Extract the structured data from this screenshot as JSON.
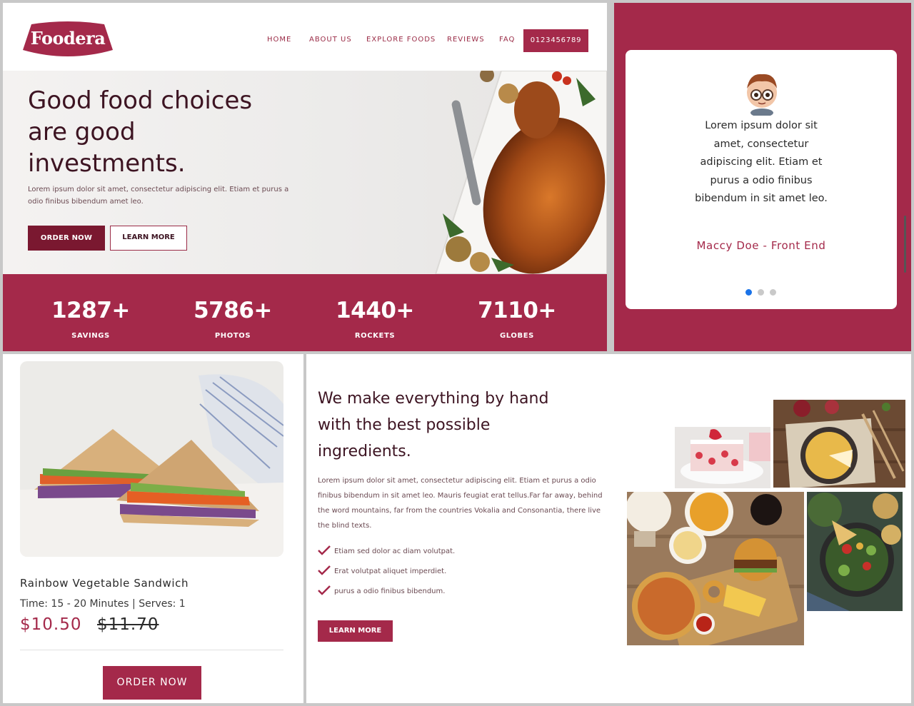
{
  "brand": {
    "name": "Foodera",
    "primary_color": "#a4294a",
    "dark_color": "#7a1830"
  },
  "header": {
    "nav": [
      "HOME",
      "ABOUT US",
      "EXPLORE FOODS",
      "REVIEWS",
      "FAQ"
    ],
    "phone": "0123456789"
  },
  "hero": {
    "title": "Good food choices are good investments.",
    "subtitle": "Lorem ipsum dolor sit amet, consectetur adipiscing elit. Etiam et purus a odio finibus bibendum amet leo.",
    "order_label": "ORDER NOW",
    "learn_label": "LEARN MORE",
    "image_icon": "roast-turkey-image"
  },
  "stats": [
    {
      "number": "1287+",
      "label": "SAVINGS"
    },
    {
      "number": "5786+",
      "label": "PHOTOS"
    },
    {
      "number": "1440+",
      "label": "ROCKETS"
    },
    {
      "number": "7110+",
      "label": "GLOBES"
    }
  ],
  "testimonial": {
    "quote": "Lorem ipsum dolor sit amet, consectetur adipiscing elit. Etiam et purus a odio finibus bibendum in sit amet leo.",
    "author": "Maccy Doe - Front End",
    "slides": 3,
    "active_slide": 1
  },
  "product": {
    "name": "Rainbow Vegetable Sandwich",
    "meta": "Time: 15 - 20 Minutes | Serves: 1",
    "price": "$10.50",
    "old_price": "$11.70",
    "order_label": "ORDER NOW"
  },
  "about": {
    "title": "We make everything by hand with the best possible ingredients.",
    "text": "Lorem ipsum dolor sit amet, consectetur adipiscing elit. Etiam et purus a odio finibus bibendum in sit amet leo. Mauris feugiat erat tellus.Far far away, behind the word mountains, far from the countries Vokalia and Consonantia, there live the blind texts.",
    "list": [
      "Etiam sed dolor ac diam volutpat.",
      "Erat volutpat aliquet imperdiet.",
      "purus a odio finibus bibendum."
    ],
    "button_label": "LEARN MORE",
    "gallery_images": [
      "strawberry-cake-image",
      "quiche-image",
      "fast-food-platter-image",
      "salad-bowl-image"
    ]
  }
}
